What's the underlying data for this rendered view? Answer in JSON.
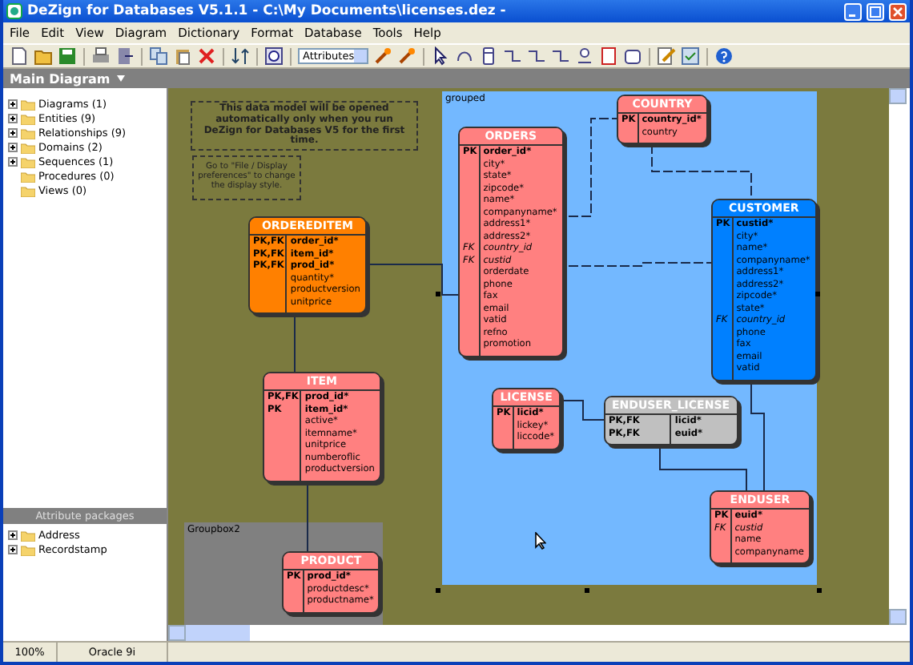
{
  "window": {
    "title": "DeZign for Databases V5.1.1 - C:\\My Documents\\licenses.dez -"
  },
  "menu": [
    "File",
    "Edit",
    "View",
    "Diagram",
    "Dictionary",
    "Format",
    "Database",
    "Tools",
    "Help"
  ],
  "toolbar": {
    "view_select": "Attributes"
  },
  "diagram_tab": "Main Diagram",
  "tree": [
    {
      "label": "Diagrams (1)",
      "expandable": true
    },
    {
      "label": "Entities (9)",
      "expandable": true
    },
    {
      "label": "Relationships (9)",
      "expandable": true
    },
    {
      "label": "Domains (2)",
      "expandable": true
    },
    {
      "label": "Sequences (1)",
      "expandable": true
    },
    {
      "label": "Procedures (0)",
      "expandable": false
    },
    {
      "label": "Views (0)",
      "expandable": false
    }
  ],
  "attribute_packages": {
    "title": "Attribute packages",
    "items": [
      {
        "label": "Address",
        "expandable": true
      },
      {
        "label": "Recordstamp",
        "expandable": true
      }
    ]
  },
  "canvas": {
    "groups": [
      {
        "label": "grouped",
        "color": "#73b8ff"
      },
      {
        "label": "Groupbox2",
        "color": "#808080"
      }
    ],
    "notes": [
      {
        "text": "This data model will be opened automatically only when you run DeZign for Databases V5 for the first time.",
        "emphasis": true
      },
      {
        "text": "Go to \"File / Display preferences\" to change the display style.",
        "emphasis": false
      }
    ],
    "entities": [
      {
        "name": "ORDEREDITEM",
        "color": "#ff8000",
        "rows": [
          {
            "key": "PK,FK",
            "name": "order_id*",
            "kind": "pk"
          },
          {
            "key": "PK,FK",
            "name": "item_id*",
            "kind": "pk"
          },
          {
            "key": "PK,FK",
            "name": "prod_id*",
            "kind": "pk"
          },
          {
            "name": "quantity*",
            "kind": "attr"
          },
          {
            "name": "productversion",
            "kind": "attr"
          },
          {
            "name": "unitprice",
            "kind": "attr"
          }
        ]
      },
      {
        "name": "ITEM",
        "color": "#ff8080",
        "rows": [
          {
            "key": "PK,FK",
            "name": "prod_id*",
            "kind": "pk"
          },
          {
            "key": "PK",
            "name": "item_id*",
            "kind": "pk"
          },
          {
            "name": "active*",
            "kind": "attr"
          },
          {
            "name": "itemname*",
            "kind": "attr"
          },
          {
            "name": "unitprice",
            "kind": "attr"
          },
          {
            "name": "numberoflic",
            "kind": "attr"
          },
          {
            "name": "productversion",
            "kind": "attr"
          }
        ]
      },
      {
        "name": "PRODUCT",
        "color": "#ff8080",
        "rows": [
          {
            "key": "PK",
            "name": "prod_id*",
            "kind": "pk"
          },
          {
            "name": "productdesc*",
            "kind": "attr"
          },
          {
            "name": "productname*",
            "kind": "attr"
          }
        ]
      },
      {
        "name": "ORDERS",
        "color": "#ff8080",
        "rows": [
          {
            "key": "PK",
            "name": "order_id*",
            "kind": "pk"
          },
          {
            "name": "city*",
            "kind": "attr"
          },
          {
            "name": "state*",
            "kind": "attr"
          },
          {
            "name": "zipcode*",
            "kind": "attr"
          },
          {
            "name": "name*",
            "kind": "attr"
          },
          {
            "name": "companyname*",
            "kind": "attr"
          },
          {
            "name": "address1*",
            "kind": "attr"
          },
          {
            "name": "address2*",
            "kind": "attr"
          },
          {
            "key": "FK",
            "name": "country_id",
            "kind": "fk"
          },
          {
            "key": "FK",
            "name": "custid",
            "kind": "fk"
          },
          {
            "name": "orderdate",
            "kind": "attr"
          },
          {
            "name": "phone",
            "kind": "attr"
          },
          {
            "name": "fax",
            "kind": "attr"
          },
          {
            "name": "email",
            "kind": "attr"
          },
          {
            "name": "vatid",
            "kind": "attr"
          },
          {
            "name": "refno",
            "kind": "attr"
          },
          {
            "name": "promotion",
            "kind": "attr"
          }
        ]
      },
      {
        "name": "COUNTRY",
        "color": "#ff8080",
        "rows": [
          {
            "key": "PK",
            "name": "country_id*",
            "kind": "pk"
          },
          {
            "name": "country",
            "kind": "attr"
          }
        ]
      },
      {
        "name": "CUSTOMER",
        "color": "#0080ff",
        "rows": [
          {
            "key": "PK",
            "name": "custid*",
            "kind": "pk"
          },
          {
            "name": "city*",
            "kind": "attr"
          },
          {
            "name": "name*",
            "kind": "attr"
          },
          {
            "name": "companyname*",
            "kind": "attr"
          },
          {
            "name": "address1*",
            "kind": "attr"
          },
          {
            "name": "address2*",
            "kind": "attr"
          },
          {
            "name": "zipcode*",
            "kind": "attr"
          },
          {
            "name": "state*",
            "kind": "attr"
          },
          {
            "key": "FK",
            "name": "country_id",
            "kind": "fk"
          },
          {
            "name": "phone",
            "kind": "attr"
          },
          {
            "name": "fax",
            "kind": "attr"
          },
          {
            "name": "email",
            "kind": "attr"
          },
          {
            "name": "vatid",
            "kind": "attr"
          }
        ]
      },
      {
        "name": "LICENSE",
        "color": "#ff8080",
        "rows": [
          {
            "key": "PK",
            "name": "licid*",
            "kind": "pk"
          },
          {
            "name": "lickey*",
            "kind": "attr"
          },
          {
            "name": "liccode*",
            "kind": "attr"
          }
        ]
      },
      {
        "name": "ENDUSER_LICENSE",
        "color": "#c0c0c0",
        "rows": [
          {
            "key": "PK,FK",
            "name": "licid*",
            "kind": "pk"
          },
          {
            "key": "PK,FK",
            "name": "euid*",
            "kind": "pk"
          }
        ]
      },
      {
        "name": "ENDUSER",
        "color": "#ff8080",
        "rows": [
          {
            "key": "PK",
            "name": "euid*",
            "kind": "pk"
          },
          {
            "key": "FK",
            "name": "custid",
            "kind": "fk"
          },
          {
            "name": "name",
            "kind": "attr"
          },
          {
            "name": "companyname",
            "kind": "attr"
          }
        ]
      }
    ]
  },
  "status_bar": [
    "100%",
    "Oracle 9i"
  ]
}
